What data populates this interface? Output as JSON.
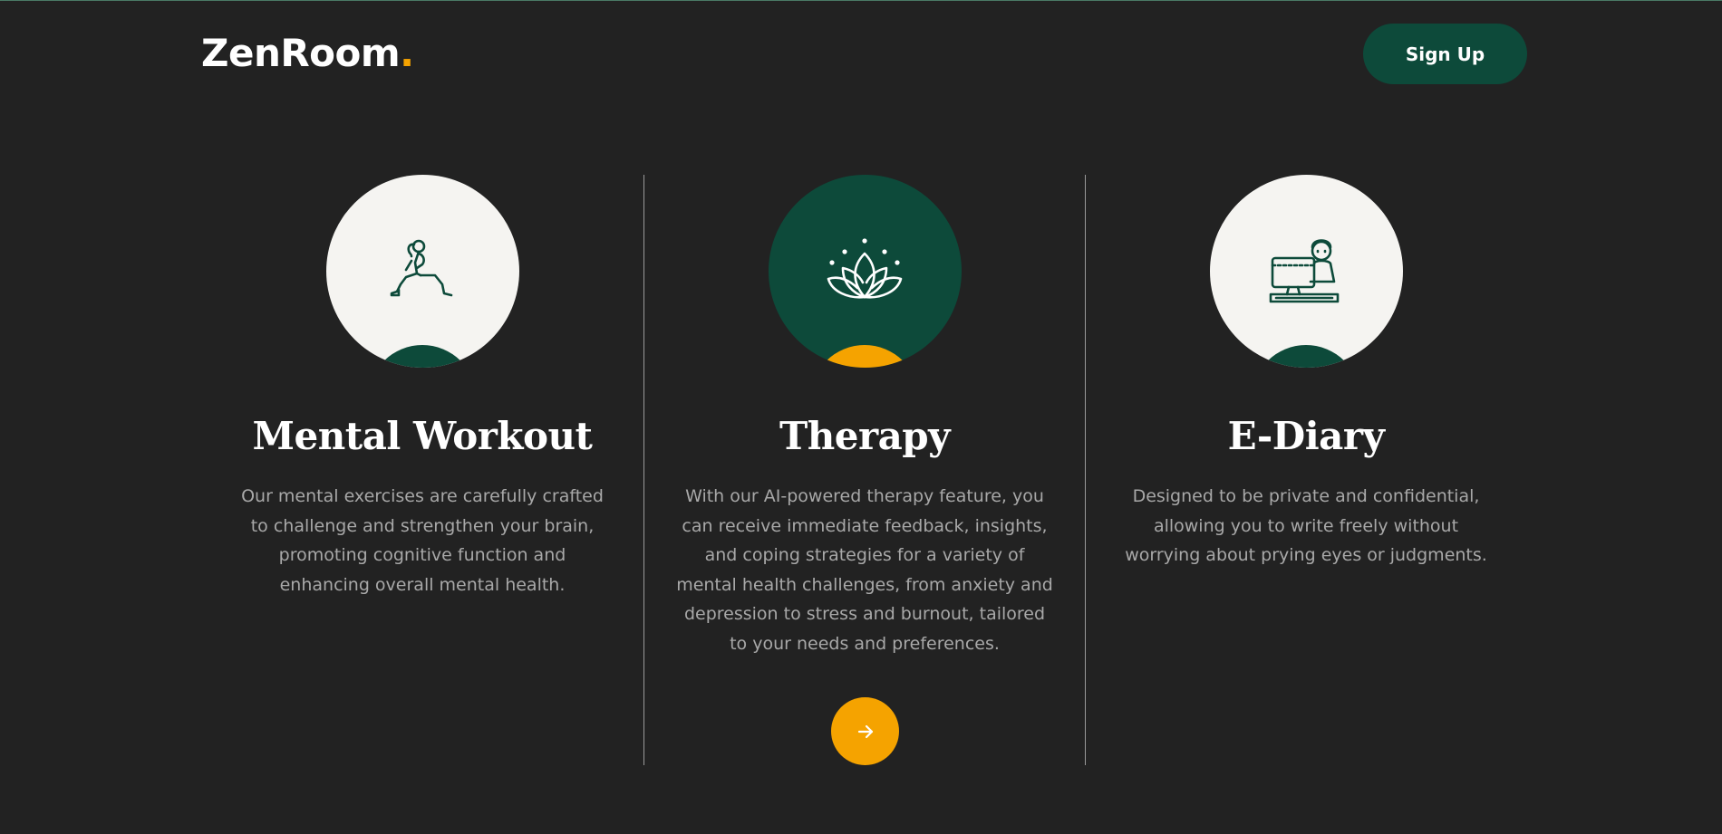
{
  "header": {
    "logo_text": "ZenRoom",
    "logo_dot": ".",
    "signup_label": "Sign Up"
  },
  "features": [
    {
      "title": "Mental Workout",
      "description": "Our mental exercises are carefully crafted to challenge and strengthen your brain, promoting cognitive function and enhancing overall mental health.",
      "icon": "workout-icon"
    },
    {
      "title": "Therapy",
      "description": "With our AI-powered therapy feature, you can receive immediate feedback, insights, and coping strategies for a variety of mental health challenges, from anxiety and depression to stress and burnout, tailored to your needs and preferences.",
      "icon": "lotus-icon"
    },
    {
      "title": "E-Diary",
      "description": "Designed to be private and confidential, allowing you to write freely without worrying about prying eyes or judgments.",
      "icon": "diary-icon"
    }
  ],
  "navigation": {
    "next_icon": "arrow-right-icon"
  },
  "colors": {
    "background": "#222222",
    "brand_green": "#0d4a3a",
    "accent_orange": "#f5a300",
    "circle_light": "#f5f4f1",
    "text_white": "#ffffff",
    "text_muted": "#a8a8a8"
  }
}
